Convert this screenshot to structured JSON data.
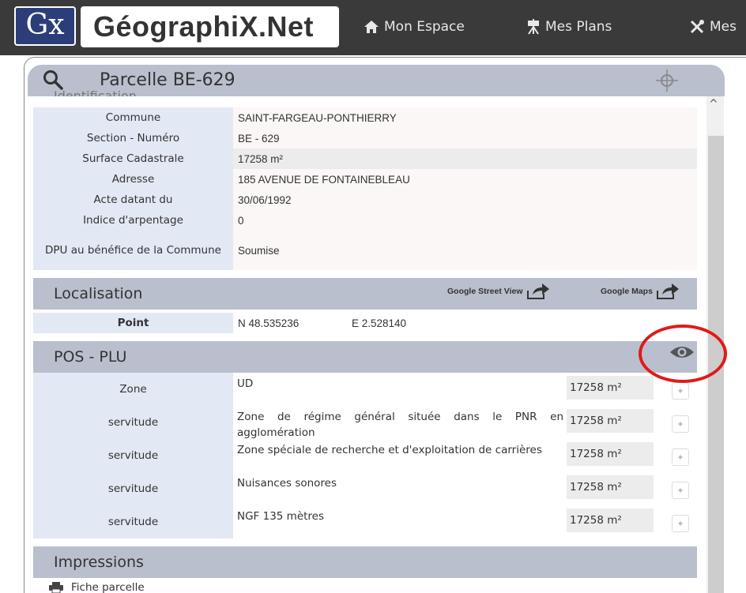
{
  "topbar": {
    "logo_mark": "Gx",
    "logo_text": "GéographiX.Net",
    "nav": [
      {
        "label": "Mon Espace",
        "icon": "home-icon"
      },
      {
        "label": "Mes Plans",
        "icon": "easel-icon"
      },
      {
        "label": "Mes",
        "icon": "tools-icon"
      }
    ]
  },
  "panel": {
    "title": "Parcelle BE-629",
    "cut_heading": "Identification"
  },
  "identification": {
    "rows": [
      {
        "label": "Commune",
        "value": "SAINT-FARGEAU-PONTHIERRY"
      },
      {
        "label": "Section - Numéro",
        "value": "BE - 629"
      },
      {
        "label": "Surface Cadastrale",
        "value": "17258 m²"
      },
      {
        "label": "Adresse",
        "value": "185 AVENUE DE FONTAINEBLEAU"
      },
      {
        "label": "Acte datant du",
        "value": "30/06/1992"
      },
      {
        "label": "Indice d'arpentage",
        "value": "0"
      },
      {
        "label": "DPU au bénéfice de la Commune",
        "value": "Soumise"
      }
    ]
  },
  "localisation": {
    "title": "Localisation",
    "street_view_label": "Google Street View",
    "maps_label": "Google Maps",
    "point_label": "Point",
    "lat": "N 48.535236",
    "lon": "E 2.528140"
  },
  "plu": {
    "title": "POS - PLU",
    "rows": [
      {
        "label": "Zone",
        "desc": "UD",
        "surface": "17258 m²"
      },
      {
        "label": "servitude",
        "desc": "Zone de régime général située dans le PNR en agglomération",
        "surface": "17258 m²"
      },
      {
        "label": "servitude",
        "desc": "Zone spéciale de recherche et d'exploitation de carrières",
        "surface": "17258 m²"
      },
      {
        "label": "servitude",
        "desc": "Nuisances sonores",
        "surface": "17258 m²"
      },
      {
        "label": "servitude",
        "desc": "NGF 135 mètres",
        "surface": "17258 m²"
      }
    ]
  },
  "impressions": {
    "title": "Impressions",
    "items": [
      {
        "label": "Fiche parcelle"
      }
    ]
  },
  "colors": {
    "topbar": "#3a3a3a",
    "header": "#b9bfcd",
    "label_cell": "#e2e8f4",
    "highlight_circle": "#e01a1a"
  }
}
